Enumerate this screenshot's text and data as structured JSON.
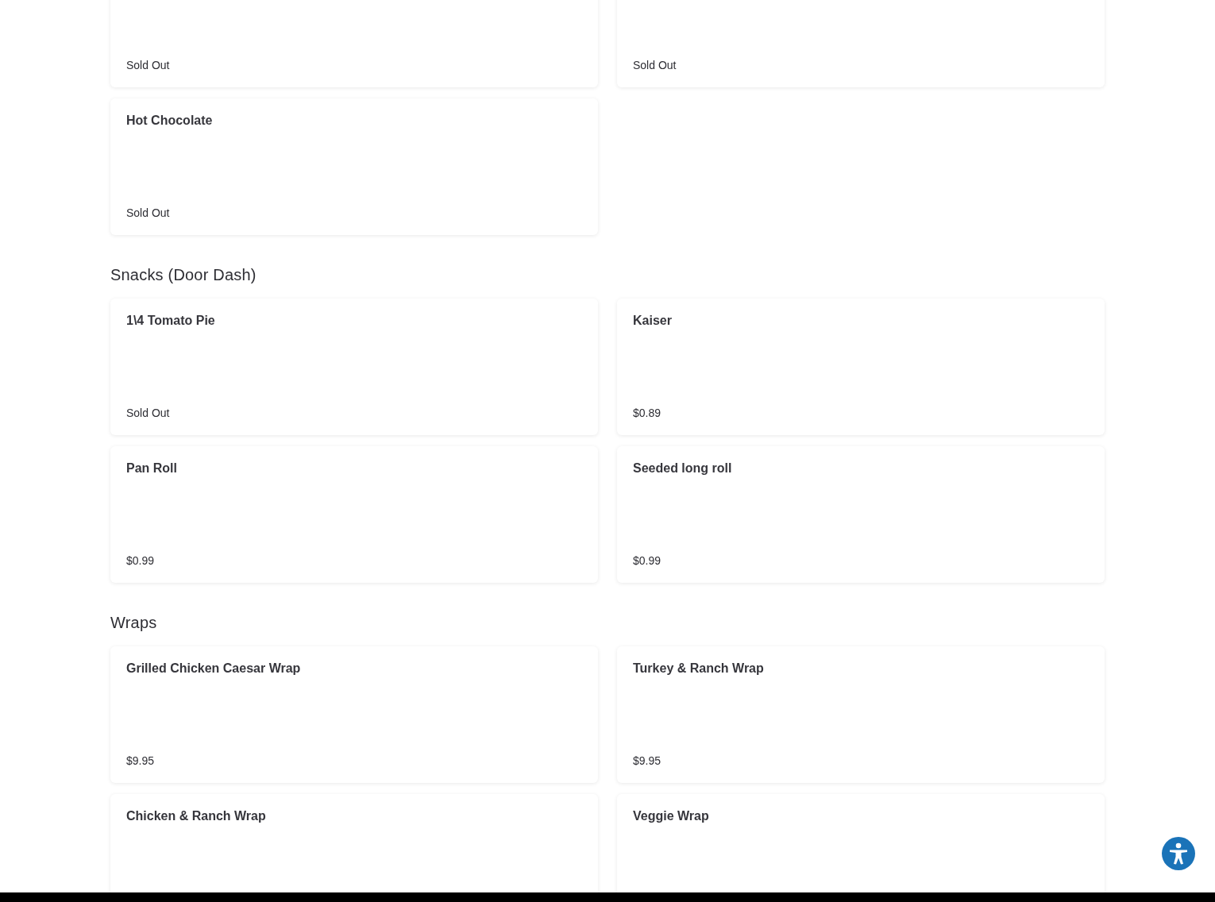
{
  "sections": [
    {
      "items": [
        {
          "price": "Sold Out"
        },
        {
          "price": "Sold Out"
        },
        {
          "name": "Hot Chocolate",
          "price": "Sold Out"
        }
      ]
    },
    {
      "title": "Snacks (Door Dash)",
      "items": [
        {
          "name": "1\\4 Tomato Pie",
          "price": "Sold Out"
        },
        {
          "name": "Kaiser",
          "price": "$0.89"
        },
        {
          "name": "Pan Roll",
          "price": "$0.99"
        },
        {
          "name": "Seeded long roll",
          "price": "$0.99"
        }
      ]
    },
    {
      "title": "Wraps",
      "items": [
        {
          "name": "Grilled Chicken Caesar Wrap",
          "price": "$9.95"
        },
        {
          "name": "Turkey & Ranch Wrap",
          "price": "$9.95"
        },
        {
          "name": "Chicken & Ranch Wrap"
        },
        {
          "name": "Veggie Wrap"
        }
      ]
    }
  ]
}
